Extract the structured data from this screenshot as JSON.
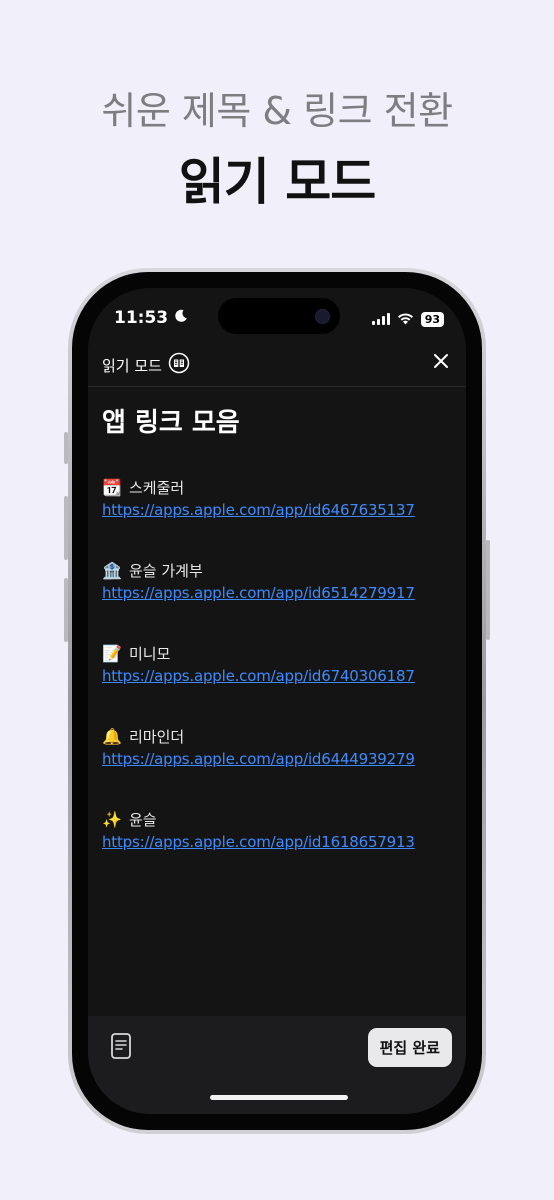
{
  "promo": {
    "headline": "쉬운 제목 & 링크 전환",
    "title": "읽기 모드"
  },
  "status_bar": {
    "time": "11:53",
    "battery": "93"
  },
  "nav": {
    "title": "읽기 모드"
  },
  "document": {
    "title": "앱 링크 모음",
    "entries": [
      {
        "emoji": "📆",
        "label": "스케줄러",
        "url": "https://apps.apple.com/app/id6467635137"
      },
      {
        "emoji": "🏦",
        "label": "윤슬 가계부",
        "url": "https://apps.apple.com/app/id6514279917"
      },
      {
        "emoji": "📝",
        "label": "미니모",
        "url": "https://apps.apple.com/app/id6740306187"
      },
      {
        "emoji": "🔔",
        "label": "리마인더",
        "url": "https://apps.apple.com/app/id6444939279"
      },
      {
        "emoji": "✨",
        "label": "윤슬",
        "url": "https://apps.apple.com/app/id1618657913"
      }
    ]
  },
  "bottom_bar": {
    "done_label": "편집 완료"
  },
  "icons": {
    "moon": "moon-icon",
    "signal": "cellular-signal-icon",
    "wifi": "wifi-icon",
    "reading_mode": "book-icon",
    "close": "close-icon",
    "document": "document-icon"
  },
  "colors": {
    "background": "#f1f0fa",
    "screen": "#141414",
    "link": "#3d8bff",
    "bottom_bar": "#1c1c1e"
  }
}
